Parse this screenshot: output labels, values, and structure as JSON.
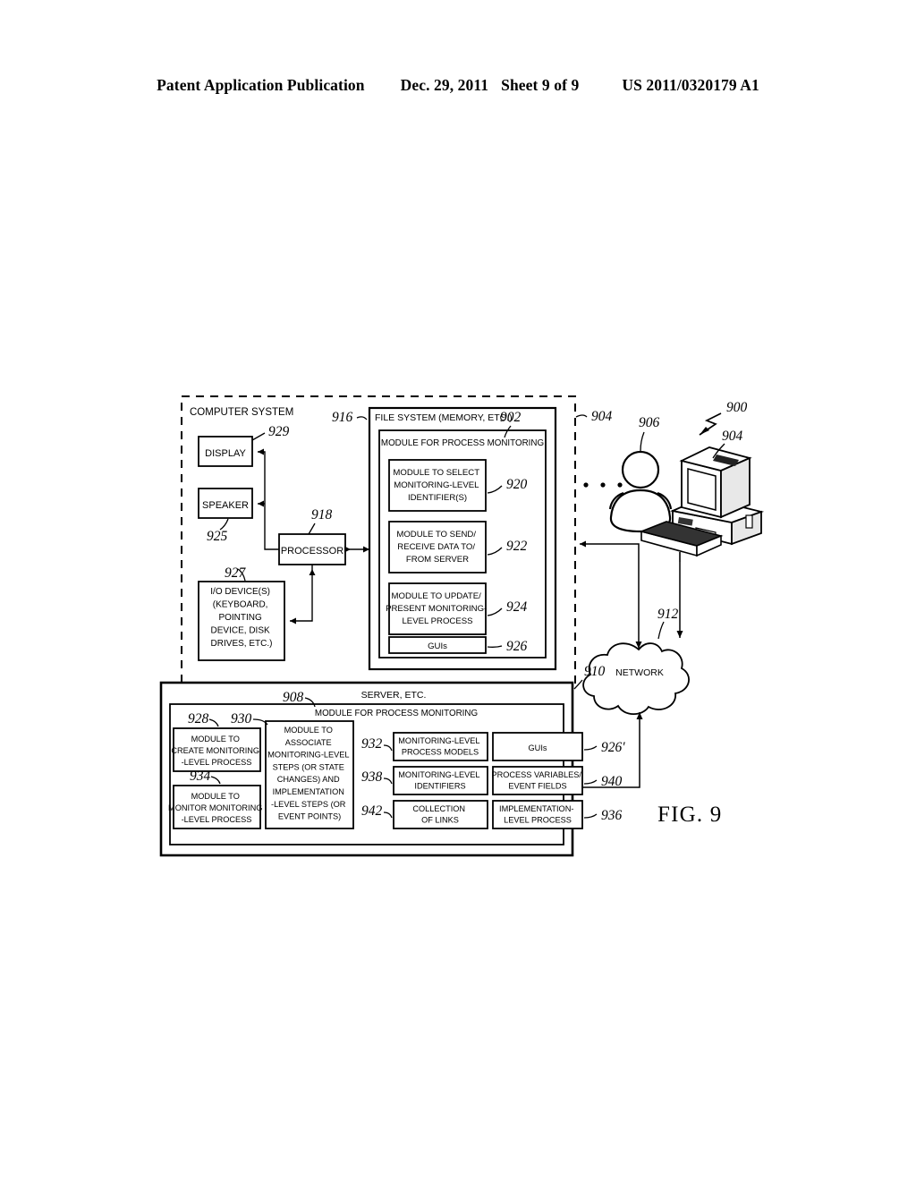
{
  "header": {
    "title": "Patent Application Publication",
    "date": "Dec. 29, 2011",
    "sheet": "Sheet 9 of 9",
    "number": "US 2011/0320179 A1"
  },
  "figure": {
    "caption": "FIG. 9",
    "ellipsis": "•   •   •",
    "computer_system": {
      "title": "COMPUTER SYSTEM",
      "ref": "904",
      "blocks": [
        {
          "name": "display",
          "label": "DISPLAY",
          "ref": "929"
        },
        {
          "name": "speaker",
          "label": "SPEAKER",
          "ref": "925"
        },
        {
          "name": "processor",
          "label": "PROCESSOR",
          "ref": "918"
        },
        {
          "name": "io-device",
          "ref": "927",
          "lines": [
            "I/O DEVICE(S)",
            "(KEYBOARD,",
            "POINTING",
            "DEVICE, DISK",
            "DRIVES, ETC.)"
          ]
        }
      ],
      "file_system": {
        "title": "FILE SYSTEM (MEMORY, ETC.)",
        "ref": "916",
        "module": {
          "title": "MODULE FOR PROCESS MONITORING",
          "ref": "902",
          "items": [
            {
              "name": "module-select-identifiers",
              "ref": "920",
              "lines": [
                "MODULE TO SELECT",
                "MONITORING-LEVEL",
                "IDENTIFIER(S)"
              ]
            },
            {
              "name": "module-send-receive",
              "ref": "922",
              "lines": [
                "MODULE TO SEND/",
                "RECEIVE DATA TO/",
                "FROM SERVER"
              ]
            },
            {
              "name": "module-update-present",
              "ref": "924",
              "lines": [
                "MODULE TO UPDATE/",
                "PRESENT MONITORING-",
                "LEVEL PROCESS"
              ]
            },
            {
              "name": "guis",
              "ref": "926",
              "lines": [
                "GUIs"
              ]
            }
          ]
        }
      }
    },
    "user": {
      "name": "user-icon",
      "ref": "906"
    },
    "workstation": {
      "name": "computer-workstation-icon",
      "ref": "904"
    },
    "system_arrow": {
      "ref": "900"
    },
    "network": {
      "label": "NETWORK",
      "ref": "912"
    },
    "server": {
      "title": "SERVER, ETC.",
      "ref": "910",
      "module": {
        "title": "MODULE FOR PROCESS MONITORING",
        "ref": "908",
        "left_items": [
          {
            "name": "module-create-process",
            "ref": "928",
            "lines": [
              "MODULE TO",
              "CREATE MONITORING",
              "-LEVEL PROCESS"
            ]
          },
          {
            "name": "module-monitor-process",
            "ref": "934",
            "lines": [
              "MODULE TO",
              "MONITOR MONITORING",
              "-LEVEL PROCESS"
            ]
          }
        ],
        "center_item": {
          "name": "module-associate-steps",
          "ref": "930",
          "lines": [
            "MODULE TO",
            "ASSOCIATE",
            "MONITORING-LEVEL",
            "STEPS (OR STATE",
            "CHANGES) AND",
            "IMPLEMENTATION",
            "-LEVEL STEPS (OR",
            "EVENT POINTS)"
          ]
        },
        "mid_items": [
          {
            "name": "monitoring-level-process-models",
            "ref": "932",
            "lines": [
              "MONITORING-LEVEL",
              "PROCESS MODELS"
            ]
          },
          {
            "name": "monitoring-level-identifiers",
            "ref": "938",
            "lines": [
              "MONITORING-LEVEL",
              "IDENTIFIERS"
            ]
          },
          {
            "name": "collection-of-links",
            "ref": "942",
            "lines": [
              "COLLECTION",
              "OF LINKS"
            ]
          }
        ],
        "right_items": [
          {
            "name": "server-guis",
            "ref": "926′",
            "lines": [
              "GUIs"
            ]
          },
          {
            "name": "process-variables-event-fields",
            "ref": "940",
            "lines": [
              "PROCESS VARIABLES/",
              "EVENT FIELDS"
            ]
          },
          {
            "name": "implementation-level-process",
            "ref": "936",
            "lines": [
              "IMPLEMENTATION-",
              "LEVEL PROCESS"
            ]
          }
        ]
      }
    }
  }
}
